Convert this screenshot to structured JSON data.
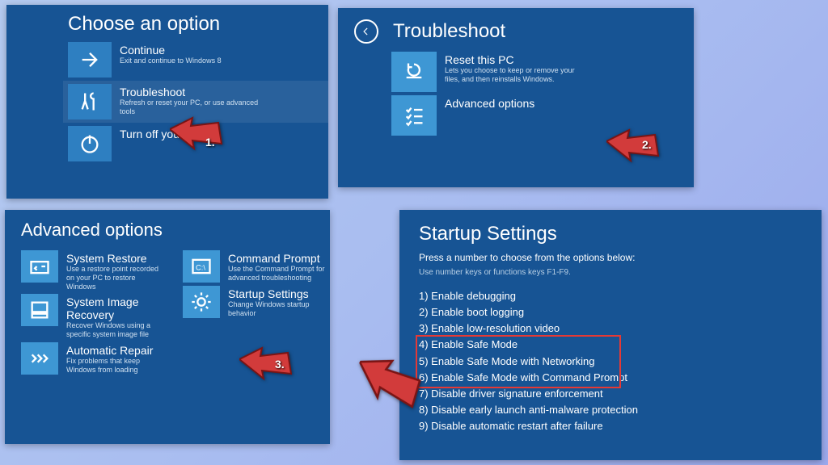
{
  "panel1": {
    "title": "Choose an option",
    "items": [
      {
        "label": "Continue",
        "sub": "Exit and continue to Windows 8"
      },
      {
        "label": "Troubleshoot",
        "sub": "Refresh or reset your PC, or use advanced tools"
      },
      {
        "label": "Turn off your PC",
        "sub": ""
      }
    ]
  },
  "panel2": {
    "title": "Troubleshoot",
    "items": [
      {
        "label": "Reset this PC",
        "sub": "Lets you choose to keep or remove your files, and then reinstalls Windows."
      },
      {
        "label": "Advanced options",
        "sub": ""
      }
    ]
  },
  "panel3": {
    "title": "Advanced options",
    "left": [
      {
        "label": "System Restore",
        "sub": "Use a restore point recorded on your PC to restore Windows"
      },
      {
        "label": "System Image Recovery",
        "sub": "Recover Windows using a specific system image file"
      },
      {
        "label": "Automatic Repair",
        "sub": "Fix problems that keep Windows from loading"
      }
    ],
    "right": [
      {
        "label": "Command Prompt",
        "sub": "Use the Command Prompt for advanced troubleshooting"
      },
      {
        "label": "Startup Settings",
        "sub": "Change Windows startup behavior"
      }
    ]
  },
  "panel4": {
    "title": "Startup Settings",
    "sub1": "Press a number to choose from the options below:",
    "sub2": "Use number keys or functions keys F1-F9.",
    "options": [
      "1) Enable debugging",
      "2) Enable boot logging",
      "3) Enable low-resolution video",
      "4) Enable Safe Mode",
      "5) Enable Safe Mode with Networking",
      "6) Enable Safe Mode with Command Prompt",
      "7) Disable driver signature enforcement",
      "8) Disable early launch anti-malware protection",
      "9) Disable automatic restart after failure"
    ]
  },
  "arrows": {
    "n1": "1.",
    "n2": "2.",
    "n3": "3."
  }
}
